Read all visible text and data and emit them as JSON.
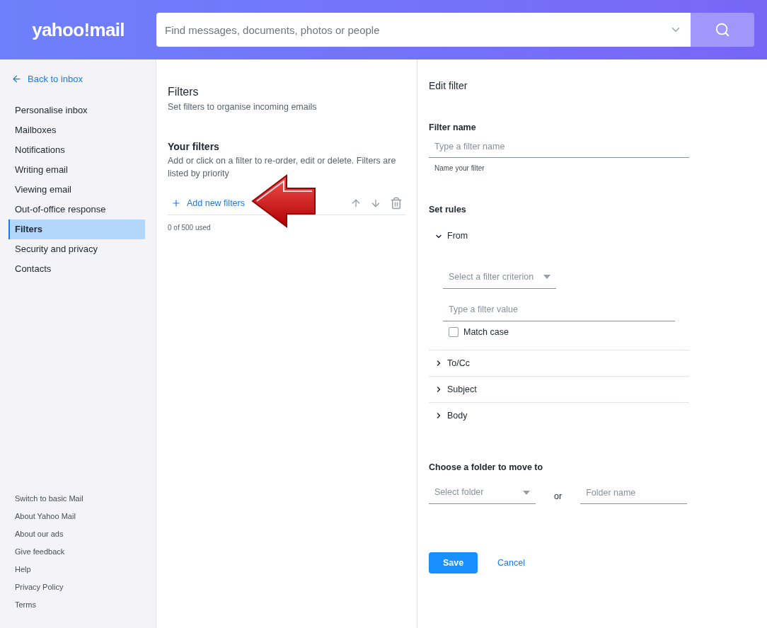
{
  "header": {
    "logo": "yahoo!mail",
    "search": {
      "placeholder": "Find messages, documents, photos or people"
    }
  },
  "sidebar": {
    "back_link": "Back to inbox",
    "items": [
      {
        "label": "Personalise inbox",
        "selected": false
      },
      {
        "label": "Mailboxes",
        "selected": false
      },
      {
        "label": "Notifications",
        "selected": false
      },
      {
        "label": "Writing email",
        "selected": false
      },
      {
        "label": "Viewing email",
        "selected": false
      },
      {
        "label": "Out-of-office response",
        "selected": false
      },
      {
        "label": "Filters",
        "selected": true
      },
      {
        "label": "Security and privacy",
        "selected": false
      },
      {
        "label": "Contacts",
        "selected": false
      }
    ],
    "footer_links": [
      "Switch to basic Mail",
      "About Yahoo Mail",
      "About our ads",
      "Give feedback",
      "Help",
      "Privacy Policy",
      "Terms"
    ]
  },
  "filters_panel": {
    "title": "Filters",
    "subtitle": "Set filters to organise incoming emails",
    "section_title": "Your filters",
    "section_description": "Add or click on a filter to re-order, edit or delete. Filters are listed by priority",
    "add_button": "Add new filters",
    "usage": "0 of 500 used"
  },
  "edit_filter": {
    "title": "Edit filter",
    "filter_name_label": "Filter name",
    "filter_name_placeholder": "Type a filter name",
    "filter_name_hint": "Name your filter",
    "rules_label": "Set rules",
    "rules": [
      {
        "label": "From",
        "expanded": true,
        "criterion_placeholder": "Select a filter criterion",
        "value_placeholder": "Type a filter value",
        "match_case": {
          "label": "Match case",
          "checked": false
        }
      },
      {
        "label": "To/Cc",
        "expanded": false
      },
      {
        "label": "Subject",
        "expanded": false
      },
      {
        "label": "Body",
        "expanded": false
      }
    ],
    "folder_label": "Choose a folder to move to",
    "folder_select_placeholder": "Select folder",
    "or_text": "or",
    "folder_name_placeholder": "Folder name",
    "save_button": "Save",
    "cancel_button": "Cancel"
  }
}
